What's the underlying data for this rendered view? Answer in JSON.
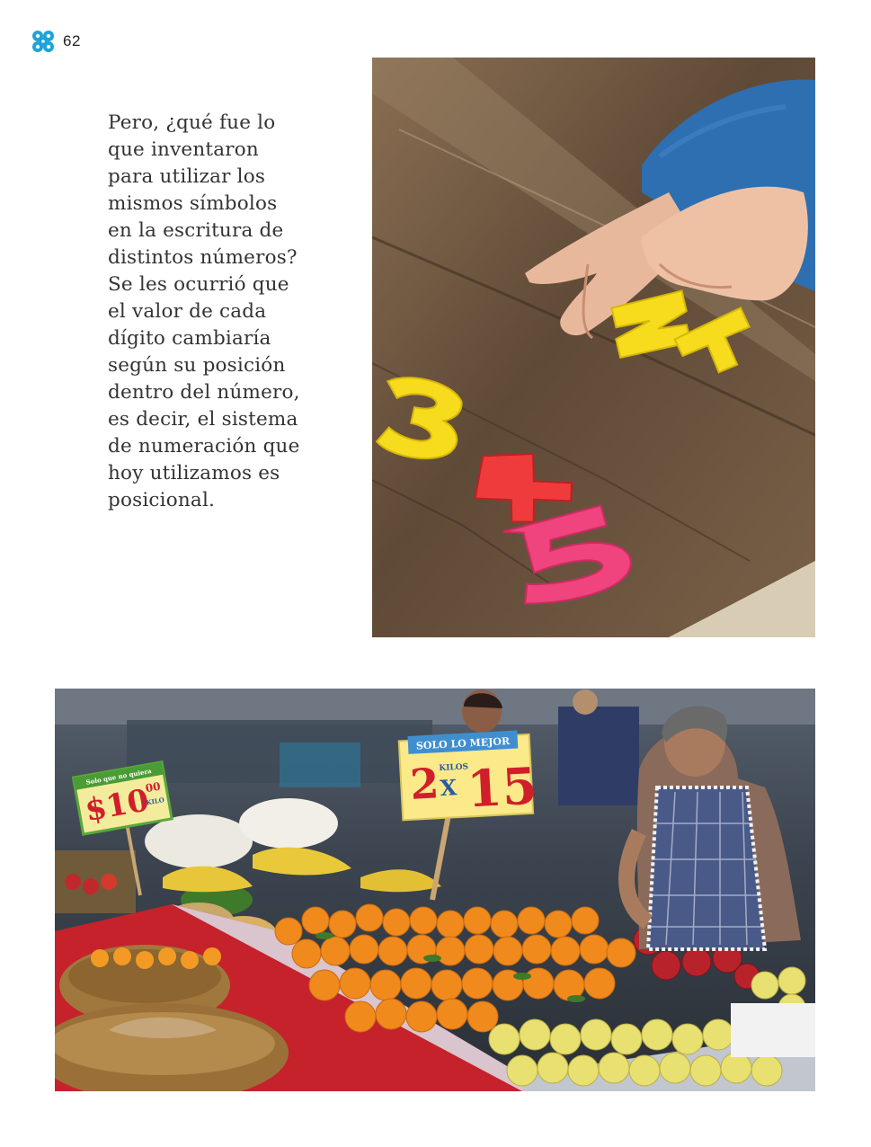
{
  "page": {
    "number": "62",
    "icon": "flower-icon",
    "accent_color": "#1aa3d9"
  },
  "body_text": {
    "lines": [
      "Pero, ¿qué fue lo",
      "que inventaron",
      "para utilizar los",
      "mismos símbolos",
      "en la escritura de",
      "distintos números?",
      "Se les ocurrió que",
      "el valor de cada",
      "dígito cambiaría",
      "según su posición",
      "dentro del número,",
      "es decir, el sistema",
      "de numeración que",
      "hoy utilizamos es",
      "posicional."
    ]
  },
  "photo_numbers": {
    "digits": [
      "2",
      "1",
      "3",
      "4",
      "5"
    ],
    "colors": {
      "wood": "#6b5440",
      "yellow": "#f6dc1c",
      "red": "#ef3b3b",
      "pink": "#f0447e",
      "sleeve": "#2d6fb0",
      "skin": "#e8b89c"
    }
  },
  "photo_market": {
    "sign_main": {
      "top": "SOLO LO MEJOR",
      "qty": "2",
      "unit": "KILOS",
      "x": "X",
      "price": "15"
    },
    "sign_left": {
      "top": "Solo que no quiera",
      "price": "$10",
      "cents": "00",
      "unit": "KILO"
    },
    "colors": {
      "orange": "#f08a1c",
      "yellow_apple": "#e8e070",
      "red_apple": "#b8232b",
      "tablecloth": "#c5222b",
      "basket": "#a0783e",
      "apron": "#4a5a88"
    }
  }
}
